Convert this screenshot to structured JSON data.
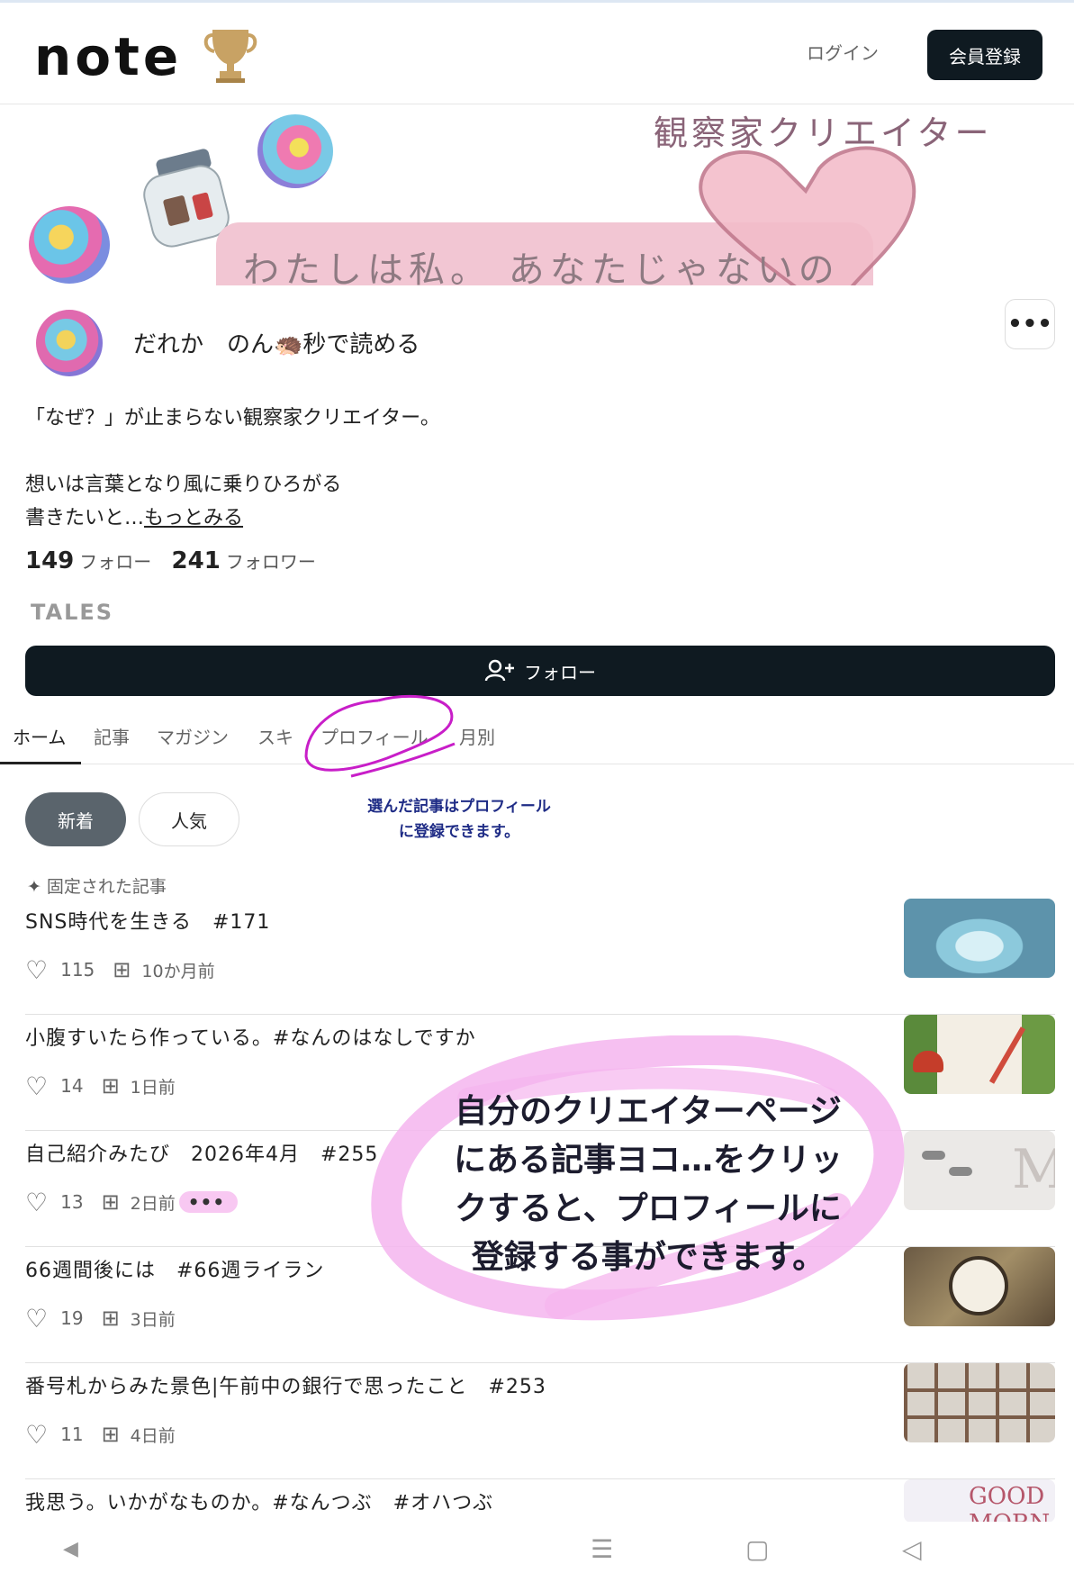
{
  "header": {
    "logo_text": "note",
    "login_label": "ログイン",
    "signup_label": "会員登録"
  },
  "banner": {
    "subtitle": "観察家クリエイター",
    "tagline": "わたしは私。 あなたじゃないの"
  },
  "profile": {
    "name": "だれか　のん🦔秒で読める",
    "bio_line1": "「なぜ？」が止まらない観察家クリエイター。",
    "bio_line2": "想いは言葉となり風に乗りひろがる",
    "bio_line3": "書きたいと…",
    "bio_more": "もっとみる",
    "following_count": "149",
    "following_label": "フォロー",
    "followers_count": "241",
    "followers_label": "フォロワー",
    "badge": "TALES",
    "follow_button": "フォロー",
    "more_menu": "•••"
  },
  "tabs": [
    {
      "label": "ホーム",
      "active": true
    },
    {
      "label": "記事"
    },
    {
      "label": "マガジン"
    },
    {
      "label": "スキ"
    },
    {
      "label": "プロフィール"
    },
    {
      "label": "月別"
    }
  ],
  "filters": {
    "new": "新着",
    "popular": "人気"
  },
  "annotation_small": "選んだ記事はプロフィール\nに登録できます。",
  "annotation_big": "自分のクリエイターページ\nにある記事ヨコ…をクリッ\nクすると、プロフィールに\n登録する事ができます。",
  "pinned_label": "固定された記事",
  "articles": [
    {
      "title": "SNS時代を生きる　#171",
      "likes": "115",
      "date": "10か月前"
    },
    {
      "title": "小腹すいたら作っている。#なんのはなしですか",
      "likes": "14",
      "date": "1日前"
    },
    {
      "title": "自己紹介みたび　2026年4月　#255",
      "likes": "13",
      "date": "2日前",
      "menu": "•••"
    },
    {
      "title": "66週間後には　#66週ライラン",
      "likes": "19",
      "date": "3日前"
    },
    {
      "title": "番号札からみた景色|午前中の銀行で思ったこと　#253",
      "likes": "11",
      "date": "4日前"
    },
    {
      "title": "我思う。いかがなものか。#なんつぶ　#オハつぶ"
    }
  ],
  "thumbs": {
    "good_morning": "GOOD MORN"
  },
  "colors": {
    "primary_dark": "#0f1a21",
    "filter_active": "#5a646c",
    "annotation_pink": "#f5b5ee",
    "annotation_magenta": "#c81ec8"
  },
  "icons": [
    "trophy-icon",
    "heart-icon",
    "magazine-add-icon",
    "pin-icon",
    "add-user-icon",
    "back-nav-icon",
    "recent-apps-icon",
    "home-nav-icon"
  ]
}
